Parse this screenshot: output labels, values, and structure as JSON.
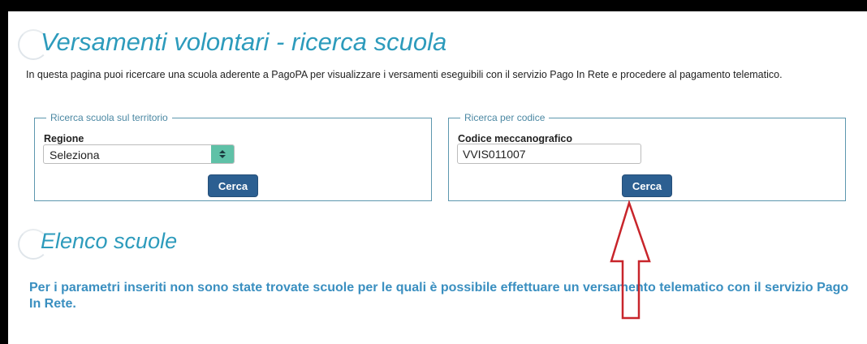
{
  "page": {
    "title": "Versamenti volontari - ricerca scuola",
    "description": "In questa pagina puoi ricercare una scuola aderente a PagoPA per visualizzare i versamenti eseguibili con il servizio Pago In Rete e procedere al pagamento telematico."
  },
  "search_territory": {
    "legend": "Ricerca scuola sul territorio",
    "region_label": "Regione",
    "region_value": "Seleziona",
    "button_label": "Cerca"
  },
  "search_code": {
    "legend": "Ricerca per codice",
    "code_label": "Codice meccanografico",
    "code_value": "VVIS011007",
    "button_label": "Cerca"
  },
  "results": {
    "title": "Elenco scuole",
    "message": "Per i parametri inseriti non sono state trovate scuole per le quali è possibile effettuare un versamento telematico con il servizio Pago In Rete."
  },
  "colors": {
    "accent": "#2d9bbc",
    "button": "#2c5f91",
    "annotation_arrow": "#c8252b"
  },
  "icons": {
    "select_arrow": "sort-up-down-icon",
    "annotation": "red-up-arrow-icon"
  }
}
